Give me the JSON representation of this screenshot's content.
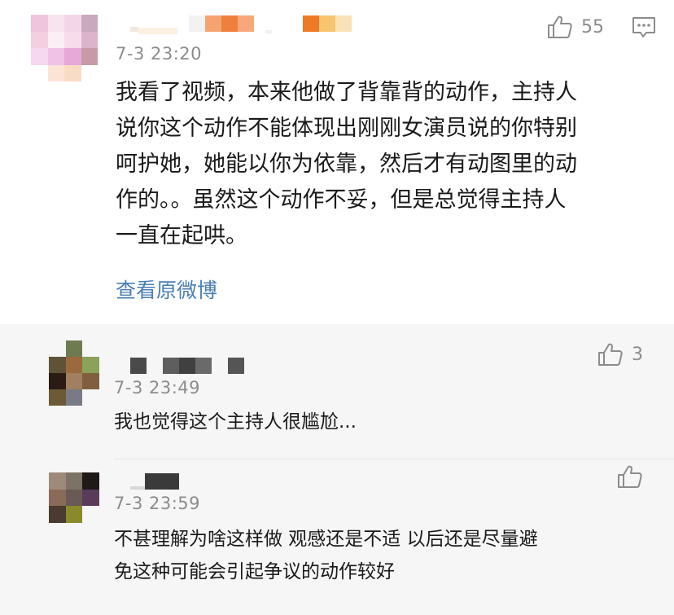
{
  "main_comment": {
    "time": "7-3 23:20",
    "like_count": "55",
    "content_lines": [
      "我看了视频，本来他做了背靠背的动作，主持人",
      "说你这个动作不能体现出刚刚女演员说的你特别",
      "呵护她，她能以你为依靠，然后才有动图里的动",
      "作的。。虽然这个动作不妥，但是总觉得主持人",
      "一直在起哄。"
    ],
    "view_original": "查看原微博"
  },
  "replies": [
    {
      "time": "7-3 23:49",
      "like_count": "3",
      "content_lines": [
        "我也觉得这个主持人很尴尬..."
      ]
    },
    {
      "time": "7-3 23:59",
      "like_count": "",
      "content_lines": [
        "不甚理解为啥这样做 观感还是不适 以后还是尽量避",
        "免这种可能会引起争议的动作较好"
      ]
    }
  ],
  "icons": {
    "like": "thumbs-up-icon",
    "comment": "comment-bubble-icon"
  },
  "colors": {
    "link": "#4a7fb5",
    "meta": "#8c8c8c",
    "reply_background": "#f6f6f6"
  }
}
